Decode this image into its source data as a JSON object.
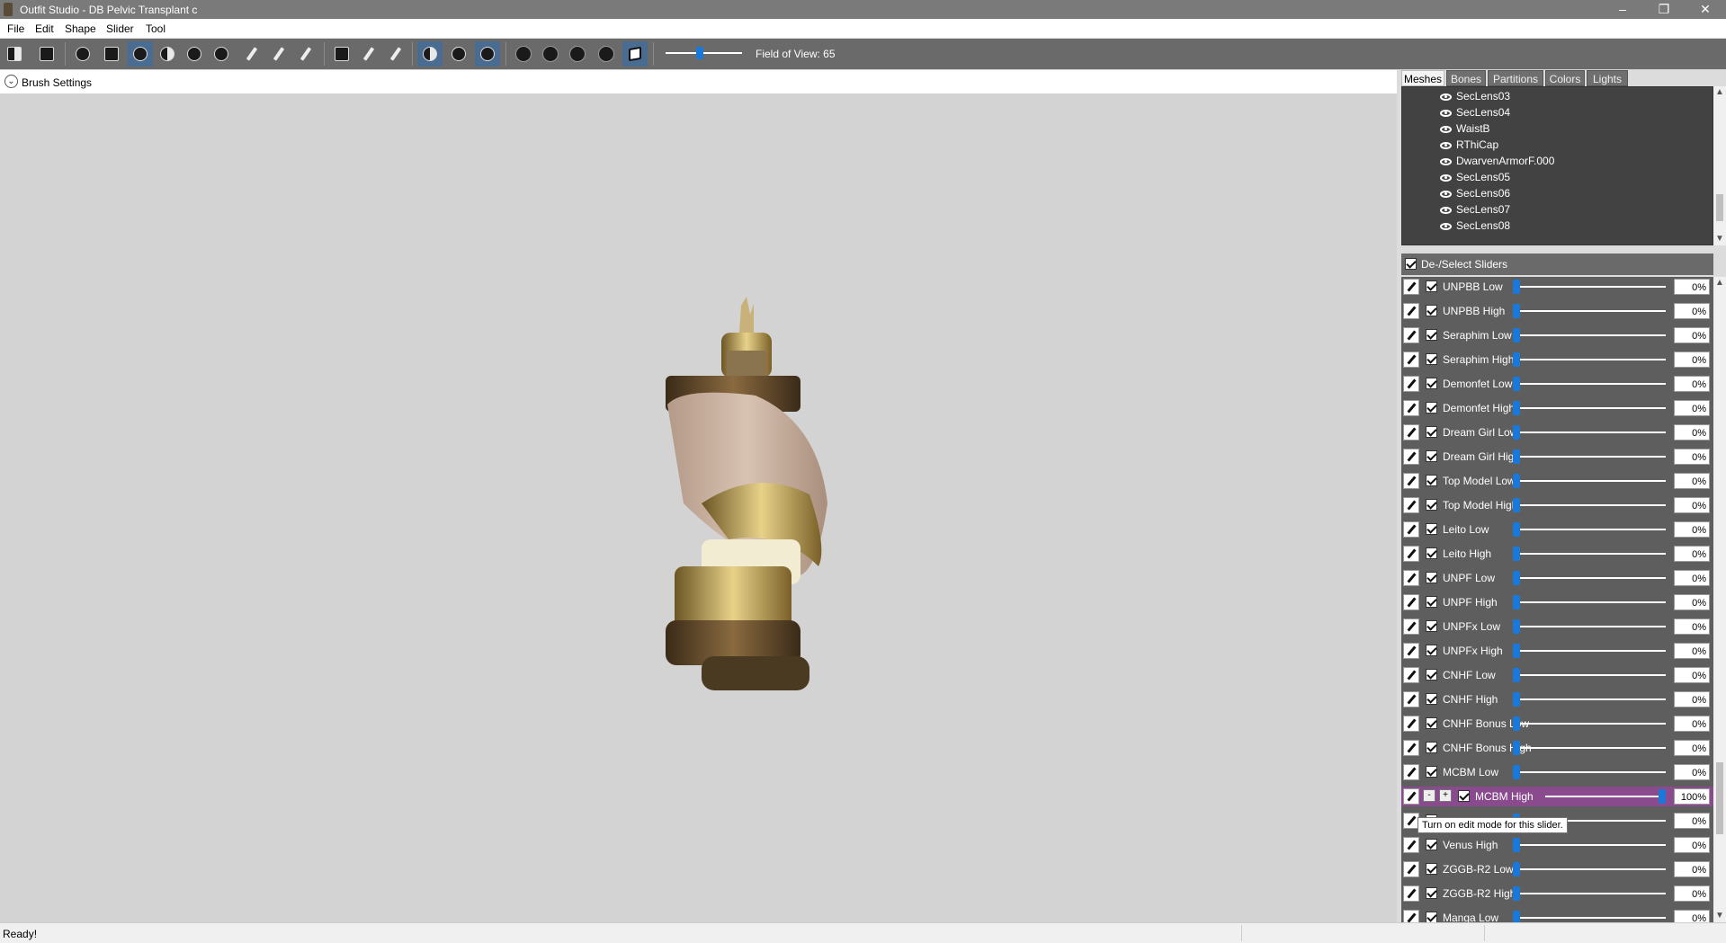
{
  "window": {
    "title": "Outfit Studio - DB Pelvic Transplant c"
  },
  "window_controls": {
    "minimize": "–",
    "restore": "❐",
    "close": "✕"
  },
  "menu": [
    "File",
    "Edit",
    "Shape",
    "Slider",
    "Tool"
  ],
  "toolbar": {
    "fov_label": "Field of View: 65",
    "fov_value": 65
  },
  "brush": {
    "label": "Brush Settings",
    "toggle": "⌄"
  },
  "tabs": [
    "Meshes",
    "Bones",
    "Partitions",
    "Colors",
    "Lights"
  ],
  "meshes": [
    "SecLens03",
    "SecLens04",
    "WaistB",
    "RThiCap",
    "DwarvenArmorF.000",
    "SecLens05",
    "SecLens06",
    "SecLens07",
    "SecLens08"
  ],
  "sliders_header": "De-/Select Sliders",
  "sliders": [
    {
      "name": "UNPBB Low",
      "value": "0%",
      "frac": 0.0
    },
    {
      "name": "UNPBB High",
      "value": "0%",
      "frac": 0.0
    },
    {
      "name": "Seraphim Low",
      "value": "0%",
      "frac": 0.0
    },
    {
      "name": "Seraphim High",
      "value": "0%",
      "frac": 0.0
    },
    {
      "name": "Demonfet Low",
      "value": "0%",
      "frac": 0.0
    },
    {
      "name": "Demonfet High",
      "value": "0%",
      "frac": 0.0
    },
    {
      "name": "Dream Girl Low",
      "value": "0%",
      "frac": 0.0
    },
    {
      "name": "Dream Girl High",
      "value": "0%",
      "frac": 0.0
    },
    {
      "name": "Top Model Low",
      "value": "0%",
      "frac": 0.0
    },
    {
      "name": "Top Model High",
      "value": "0%",
      "frac": 0.0
    },
    {
      "name": "Leito Low",
      "value": "0%",
      "frac": 0.0
    },
    {
      "name": "Leito High",
      "value": "0%",
      "frac": 0.0
    },
    {
      "name": "UNPF Low",
      "value": "0%",
      "frac": 0.0
    },
    {
      "name": "UNPF High",
      "value": "0%",
      "frac": 0.0
    },
    {
      "name": "UNPFx Low",
      "value": "0%",
      "frac": 0.0
    },
    {
      "name": "UNPFx High",
      "value": "0%",
      "frac": 0.0
    },
    {
      "name": "CNHF Low",
      "value": "0%",
      "frac": 0.0
    },
    {
      "name": "CNHF High",
      "value": "0%",
      "frac": 0.0
    },
    {
      "name": "CNHF Bonus Low",
      "value": "0%",
      "frac": 0.0
    },
    {
      "name": "CNHF Bonus High",
      "value": "0%",
      "frac": 0.0
    },
    {
      "name": "MCBM Low",
      "value": "0%",
      "frac": 0.0
    },
    {
      "name": "MCBM High",
      "value": "100%",
      "frac": 1.0,
      "active": true
    },
    {
      "name": "",
      "value": "0%",
      "frac": 0.0
    },
    {
      "name": "Venus High",
      "value": "0%",
      "frac": 0.0
    },
    {
      "name": "ZGGB-R2 Low",
      "value": "0%",
      "frac": 0.0
    },
    {
      "name": "ZGGB-R2 High",
      "value": "0%",
      "frac": 0.0
    },
    {
      "name": "Manga Low",
      "value": "0%",
      "frac": 0.0
    }
  ],
  "active_row": {
    "minus": "-",
    "plus": "+"
  },
  "tooltip": "Turn on edit mode for this slider.",
  "status": {
    "text": "Ready!"
  },
  "colors": {
    "accent": "#1a78d8",
    "active_row": "#8a4a8e",
    "panel": "#5e5e5e",
    "toolbar": "#6a6a6a"
  }
}
